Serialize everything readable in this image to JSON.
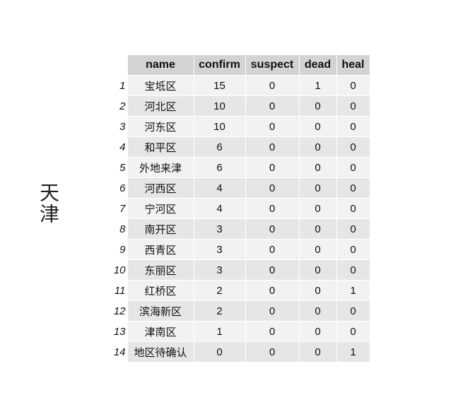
{
  "title": "天津",
  "chart_data": {
    "type": "table",
    "columns": [
      "name",
      "confirm",
      "suspect",
      "dead",
      "heal"
    ],
    "rows": [
      {
        "index": "1",
        "name": "宝坻区",
        "confirm": 15,
        "suspect": 0,
        "dead": 1,
        "heal": 0
      },
      {
        "index": "2",
        "name": "河北区",
        "confirm": 10,
        "suspect": 0,
        "dead": 0,
        "heal": 0
      },
      {
        "index": "3",
        "name": "河东区",
        "confirm": 10,
        "suspect": 0,
        "dead": 0,
        "heal": 0
      },
      {
        "index": "4",
        "name": "和平区",
        "confirm": 6,
        "suspect": 0,
        "dead": 0,
        "heal": 0
      },
      {
        "index": "5",
        "name": "外地来津",
        "confirm": 6,
        "suspect": 0,
        "dead": 0,
        "heal": 0
      },
      {
        "index": "6",
        "name": "河西区",
        "confirm": 4,
        "suspect": 0,
        "dead": 0,
        "heal": 0
      },
      {
        "index": "7",
        "name": "宁河区",
        "confirm": 4,
        "suspect": 0,
        "dead": 0,
        "heal": 0
      },
      {
        "index": "8",
        "name": "南开区",
        "confirm": 3,
        "suspect": 0,
        "dead": 0,
        "heal": 0
      },
      {
        "index": "9",
        "name": "西青区",
        "confirm": 3,
        "suspect": 0,
        "dead": 0,
        "heal": 0
      },
      {
        "index": "10",
        "name": "东丽区",
        "confirm": 3,
        "suspect": 0,
        "dead": 0,
        "heal": 0
      },
      {
        "index": "11",
        "name": "红桥区",
        "confirm": 2,
        "suspect": 0,
        "dead": 0,
        "heal": 1
      },
      {
        "index": "12",
        "name": "滨海新区",
        "confirm": 2,
        "suspect": 0,
        "dead": 0,
        "heal": 0
      },
      {
        "index": "13",
        "name": "津南区",
        "confirm": 1,
        "suspect": 0,
        "dead": 0,
        "heal": 0
      },
      {
        "index": "14",
        "name": "地区待确认",
        "confirm": 0,
        "suspect": 0,
        "dead": 0,
        "heal": 1
      }
    ]
  }
}
